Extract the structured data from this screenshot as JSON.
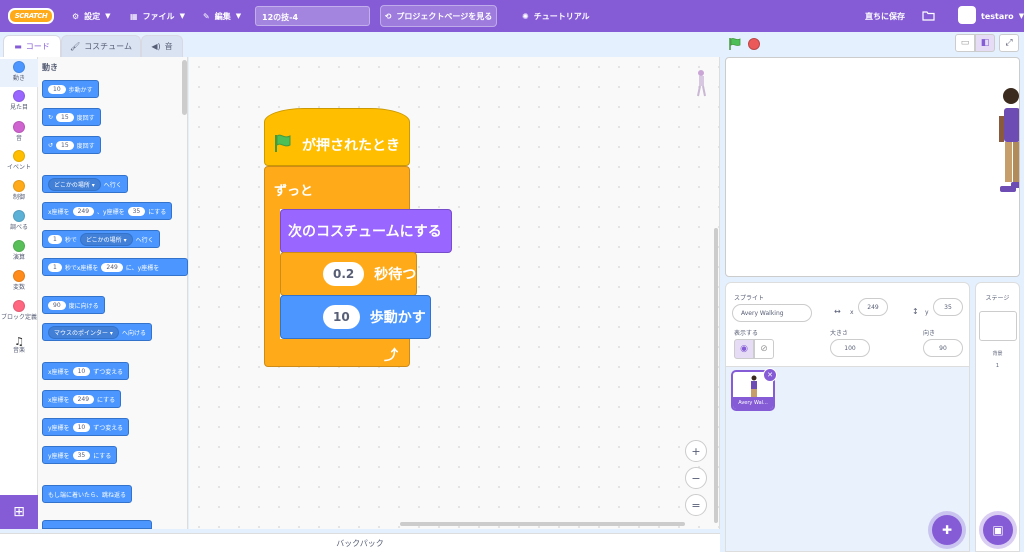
{
  "menubar": {
    "logo": "SCRATCH",
    "settings": "設定",
    "file": "ファイル",
    "edit": "編集",
    "project_title": "12の技-4",
    "project_page": "プロジェクトページを見る",
    "tutorial": "チュートリアル",
    "save_now": "直ちに保存",
    "username": "testaro"
  },
  "tabs": {
    "code": "コード",
    "costume": "コスチューム",
    "sound": "音"
  },
  "categories": [
    {
      "label": "動き",
      "color": "#4c97ff"
    },
    {
      "label": "見た目",
      "color": "#9966ff"
    },
    {
      "label": "音",
      "color": "#cf63cf"
    },
    {
      "label": "イベント",
      "color": "#ffbf00"
    },
    {
      "label": "制御",
      "color": "#ffab19"
    },
    {
      "label": "調べる",
      "color": "#5cb1d6"
    },
    {
      "label": "演算",
      "color": "#59c059"
    },
    {
      "label": "変数",
      "color": "#ff8c1a"
    },
    {
      "label": "ブロック定義",
      "color": "#ff6680"
    },
    {
      "label": "音楽",
      "color": "#0fbd8c"
    }
  ],
  "palette": {
    "heading": "動き",
    "move": {
      "value": "10",
      "text": "歩動かす"
    },
    "turn_right": {
      "value": "15",
      "text": "度回す"
    },
    "turn_left": {
      "value": "15",
      "text": "度回す"
    },
    "goto": {
      "dropdown": "どこかの場所",
      "text": "へ行く"
    },
    "gotoxy": {
      "t1": "x座標を",
      "x": "249",
      "t2": "、y座標を",
      "y": "35",
      "t3": "にする"
    },
    "glide": {
      "value": "1",
      "t1": "秒で",
      "dropdown": "どこかの場所",
      "t2": "へ行く"
    },
    "glidexy": {
      "value": "1",
      "t1": "秒でx座標を",
      "x": "249",
      "t2": "に、y座標を"
    },
    "point_dir": {
      "value": "90",
      "text": "度に向ける"
    },
    "point_towards": {
      "dropdown": "マウスのポインター",
      "text": "へ向ける"
    },
    "change_x": {
      "t1": "x座標を",
      "value": "10",
      "t2": "ずつ変える"
    },
    "set_x": {
      "t1": "x座標を",
      "value": "249",
      "t2": "にする"
    },
    "change_y": {
      "t1": "y座標を",
      "value": "10",
      "t2": "ずつ変える"
    },
    "set_y": {
      "t1": "y座標を",
      "value": "35",
      "t2": "にする"
    },
    "bounce": "もし端に着いたら、跳ね返る"
  },
  "script": {
    "hat": "が押されたとき",
    "forever": "ずっと",
    "next_costume": "次のコスチュームにする",
    "wait_value": "0.2",
    "wait_text": "秒待つ",
    "move_value": "10",
    "move_text": "歩動かす"
  },
  "zoom": {
    "in": "+",
    "out": "−",
    "reset": "="
  },
  "backpack": "バックパック",
  "sprite_info": {
    "sprite_label": "スプライト",
    "sprite_name": "Avery Walking",
    "x_label": "x",
    "x": "249",
    "y_label": "y",
    "y": "35",
    "show_label": "表示する",
    "size_label": "大きさ",
    "size": "100",
    "direction_label": "向き",
    "direction": "90"
  },
  "sprite_tile": "Avery Wal...",
  "stage_panel": {
    "title": "ステージ",
    "backdrops_label": "背景",
    "backdrops_count": "1"
  },
  "colors": {
    "accent": "#855cd6",
    "motion": "#4c97ff",
    "looks": "#9966ff",
    "control": "#ffab19",
    "events": "#ffbf00"
  }
}
